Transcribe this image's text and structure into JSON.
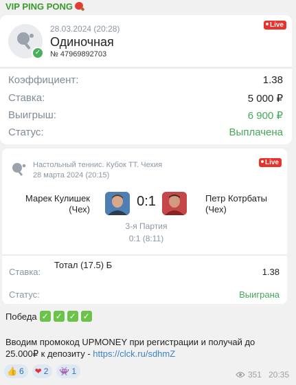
{
  "channel": {
    "name": "VIP PING PONG",
    "emoji_icon": "ping-pong-paddle-icon"
  },
  "bet_card": {
    "datetime": "28.03.2024 (20:28)",
    "type": "Одиночная",
    "ticket": "№ 47969892703",
    "live_badge": "Live",
    "rows": [
      {
        "label": "Коэффициент:",
        "value": "1.38",
        "color": "#222222"
      },
      {
        "label": "Ставка:",
        "value": "5 000 ₽",
        "color": "#222222"
      },
      {
        "label": "Выигрыш:",
        "value": "6 900 ₽",
        "color": "#43a955"
      },
      {
        "label": "Статус:",
        "value": "Выплачена",
        "color": "#43a955"
      }
    ]
  },
  "match_card": {
    "live_badge": "Live",
    "tournament": "Настольный теннис. Кубок ТТ. Чехия",
    "date": "28 марта 2024 (20:15)",
    "player1": {
      "name": "Марек Кулишек",
      "country": "(Чех)"
    },
    "player2": {
      "name": "Петр Котрбаты",
      "country": "(Чех)"
    },
    "score": "0:1",
    "set_label": "3-я Партия",
    "set_score": "0:1 (8:11)",
    "bet_label": "Ставка:",
    "bet_name": "Тотал (17.5) Б",
    "bet_odd": "1.38",
    "status_label": "Статус:",
    "status_value": "Выиграна"
  },
  "message": {
    "win_text": "Победа",
    "check_count": 4,
    "promo_text": "Вводим промокод UPMONEY при регистрации и получай до 25.000₽ к депозиту - ",
    "promo_link": "https://clck.ru/sdhmZ"
  },
  "reactions": [
    {
      "icon": "thumbs-up-icon",
      "glyph": "👍",
      "count": "6"
    },
    {
      "icon": "heart-icon",
      "glyph": "❤",
      "count": "2"
    },
    {
      "icon": "space-invader-icon",
      "glyph": "👾",
      "count": "1"
    }
  ],
  "meta": {
    "views": "351",
    "time": "20:35"
  },
  "colors": {
    "accent_green": "#43a955",
    "live_red": "#e8322b",
    "link": "#3a83c6"
  }
}
